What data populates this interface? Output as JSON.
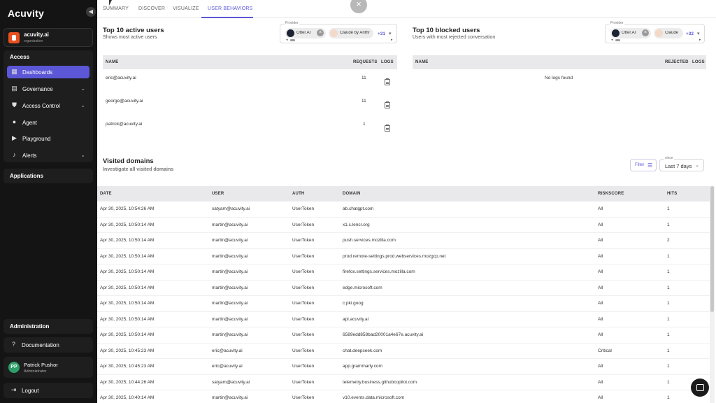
{
  "app": {
    "logo": "Acuvity"
  },
  "sidebar": {
    "org": {
      "name": "acuvity.ai",
      "subtitle": "organization"
    },
    "access_title": "Access",
    "items": [
      {
        "label": "Dashboards",
        "icon": "dashboard-icon"
      },
      {
        "label": "Governance",
        "icon": "governance-icon"
      },
      {
        "label": "Access Control",
        "icon": "shield-icon"
      },
      {
        "label": "Agent",
        "icon": "agent-icon"
      },
      {
        "label": "Playground",
        "icon": "play-icon"
      },
      {
        "label": "Alerts",
        "icon": "bell-icon"
      }
    ],
    "applications_title": "Applications",
    "administration_title": "Administration",
    "documentation_label": "Documentation",
    "user": {
      "initials": "PP",
      "name": "Patrick Pushor",
      "role": "Administrator"
    },
    "logout_label": "Logout"
  },
  "tabs": [
    "SUMMARY",
    "DISCOVER",
    "VISUALIZE",
    "USER BEHAVIORS"
  ],
  "active_users": {
    "title": "Top 10 active users",
    "subtitle": "Shows most active users",
    "provider_label": "Provider",
    "chips": [
      "Otter.AI",
      "Claude by Anthr"
    ],
    "more": "+31",
    "columns": [
      "NAME",
      "REQUESTS",
      "LOGS"
    ],
    "rows": [
      {
        "name": "eric@acuvity.ai",
        "requests": "11"
      },
      {
        "name": "george@acuvity.ai",
        "requests": "11"
      },
      {
        "name": "patrick@acuvity.ai",
        "requests": "1"
      }
    ]
  },
  "blocked_users": {
    "title": "Top 10 blocked users",
    "subtitle": "Users with most rejected conversation",
    "provider_label": "Provider",
    "chips": [
      "Otter.AI",
      "Claude"
    ],
    "more": "+32",
    "columns": [
      "NAME",
      "REJECTED",
      "LOGS"
    ],
    "empty": "No logs found"
  },
  "visited": {
    "title": "Visited domains",
    "subtitle": "Investigate all visited domains",
    "filter_label": "Filter",
    "since_label": "since",
    "since_value": "Last 7 days",
    "columns": [
      "DATE",
      "USER",
      "AUTH",
      "DOMAIN",
      "RISKSCORE",
      "HITS"
    ],
    "rows": [
      {
        "date": "Apr 30, 2025, 10:54:26 AM",
        "user": "satyam@acuvity.ai",
        "auth": "UserToken",
        "domain": "ab.chatgpt.com",
        "risk": "All",
        "hits": "1"
      },
      {
        "date": "Apr 30, 2025, 10:50:14 AM",
        "user": "martin@acuvity.ai",
        "auth": "UserToken",
        "domain": "x1.c.lencr.org",
        "risk": "All",
        "hits": "1"
      },
      {
        "date": "Apr 30, 2025, 10:50:14 AM",
        "user": "martin@acuvity.ai",
        "auth": "UserToken",
        "domain": "push.services.mozilla.com",
        "risk": "All",
        "hits": "2"
      },
      {
        "date": "Apr 30, 2025, 10:50:14 AM",
        "user": "martin@acuvity.ai",
        "auth": "UserToken",
        "domain": "prod.remote-settings.prod.webservices.mozgcp.net",
        "risk": "All",
        "hits": "1"
      },
      {
        "date": "Apr 30, 2025, 10:50:14 AM",
        "user": "martin@acuvity.ai",
        "auth": "UserToken",
        "domain": "firefox.settings.services.mozilla.com",
        "risk": "All",
        "hits": "1"
      },
      {
        "date": "Apr 30, 2025, 10:50:14 AM",
        "user": "martin@acuvity.ai",
        "auth": "UserToken",
        "domain": "edge.microsoft.com",
        "risk": "All",
        "hits": "1"
      },
      {
        "date": "Apr 30, 2025, 10:50:14 AM",
        "user": "martin@acuvity.ai",
        "auth": "UserToken",
        "domain": "c.pki.goog",
        "risk": "All",
        "hits": "1"
      },
      {
        "date": "Apr 30, 2025, 10:50:14 AM",
        "user": "martin@acuvity.ai",
        "auth": "UserToken",
        "domain": "api.acuvity.ai",
        "risk": "All",
        "hits": "1"
      },
      {
        "date": "Apr 30, 2025, 10:50:14 AM",
        "user": "martin@acuvity.ai",
        "auth": "UserToken",
        "domain": "6589edd858bad20001a4e67e.acuvity.ai",
        "risk": "All",
        "hits": "1"
      },
      {
        "date": "Apr 30, 2025, 10:45:23 AM",
        "user": "eric@acuvity.ai",
        "auth": "UserToken",
        "domain": "chat.deepseek.com",
        "risk": "Critical",
        "hits": "1"
      },
      {
        "date": "Apr 30, 2025, 10:45:23 AM",
        "user": "eric@acuvity.ai",
        "auth": "UserToken",
        "domain": "app.grammarly.com",
        "risk": "All",
        "hits": "1"
      },
      {
        "date": "Apr 30, 2025, 10:44:26 AM",
        "user": "satyam@acuvity.ai",
        "auth": "UserToken",
        "domain": "telemetry.business.githubcopilot.com",
        "risk": "All",
        "hits": "1"
      },
      {
        "date": "Apr 30, 2025, 10:40:14 AM",
        "user": "martin@acuvity.ai",
        "auth": "UserToken",
        "domain": "v10.events.data.microsoft.com",
        "risk": "All",
        "hits": "1"
      }
    ]
  },
  "colors": {
    "accent": "#5b57d6",
    "sidebar_bg": "#141414",
    "table_head": "#e9e9ec"
  }
}
